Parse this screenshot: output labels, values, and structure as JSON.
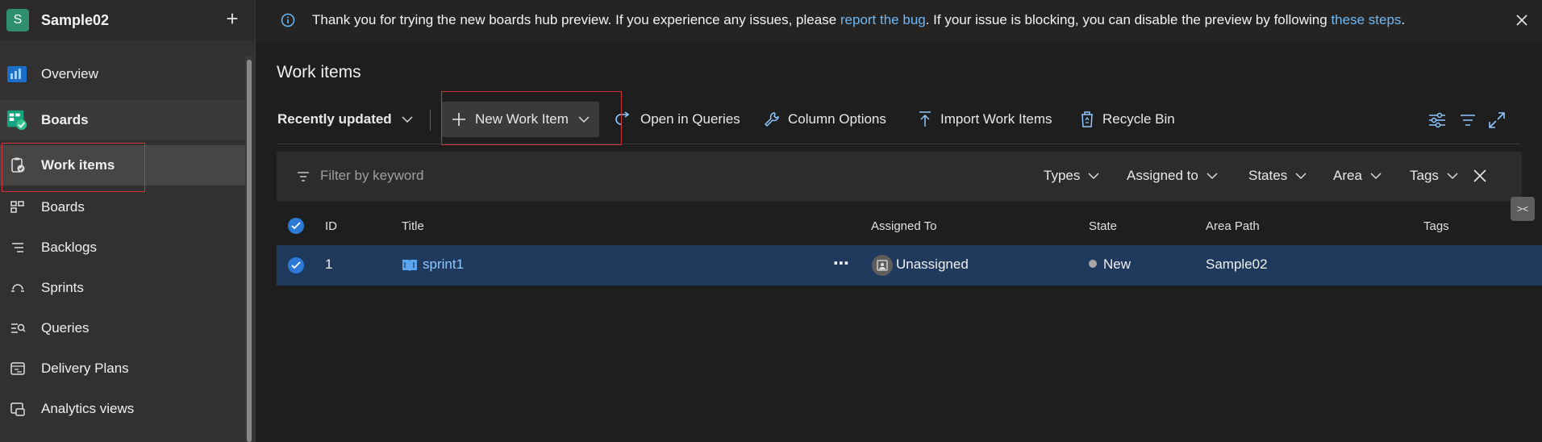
{
  "project": {
    "initial": "S",
    "name": "Sample02",
    "add_icon": "plus-icon"
  },
  "sidebar": {
    "items": [
      {
        "label": "Overview",
        "icon": "overview-icon"
      },
      {
        "label": "Boards",
        "icon": "boards-hub-icon"
      },
      {
        "label": "Work items",
        "icon": "work-items-icon"
      },
      {
        "label": "Boards",
        "icon": "boards-icon"
      },
      {
        "label": "Backlogs",
        "icon": "backlogs-icon"
      },
      {
        "label": "Sprints",
        "icon": "sprints-icon"
      },
      {
        "label": "Queries",
        "icon": "queries-icon"
      },
      {
        "label": "Delivery Plans",
        "icon": "delivery-plans-icon"
      },
      {
        "label": "Analytics views",
        "icon": "analytics-views-icon"
      }
    ]
  },
  "banner": {
    "text_1": "Thank you for trying the new boards hub preview. If you experience any issues, please ",
    "link_1": "report the bug",
    "text_2": ". If your issue is blocking, you can disable the preview by following ",
    "link_2": "these steps",
    "text_3": "."
  },
  "page": {
    "title": "Work items"
  },
  "toolbar": {
    "view": "Recently updated",
    "new_item": "New Work Item",
    "open_queries": "Open in Queries",
    "column_options": "Column Options",
    "import": "Import Work Items",
    "recycle": "Recycle Bin"
  },
  "filter": {
    "placeholder": "Filter by keyword",
    "types": "Types",
    "assigned": "Assigned to",
    "states": "States",
    "area": "Area",
    "tags": "Tags"
  },
  "grid": {
    "columns": [
      "ID",
      "Title",
      "Assigned To",
      "State",
      "Area Path",
      "Tags"
    ],
    "rows": [
      {
        "id": "1",
        "title": "sprint1",
        "assigned": "Unassigned",
        "state": "New",
        "area": "Sample02",
        "tags": ""
      }
    ]
  },
  "colors": {
    "accent": "#6cb8f6",
    "selected_row": "#1f3a5c",
    "highlight": "#d13438"
  }
}
